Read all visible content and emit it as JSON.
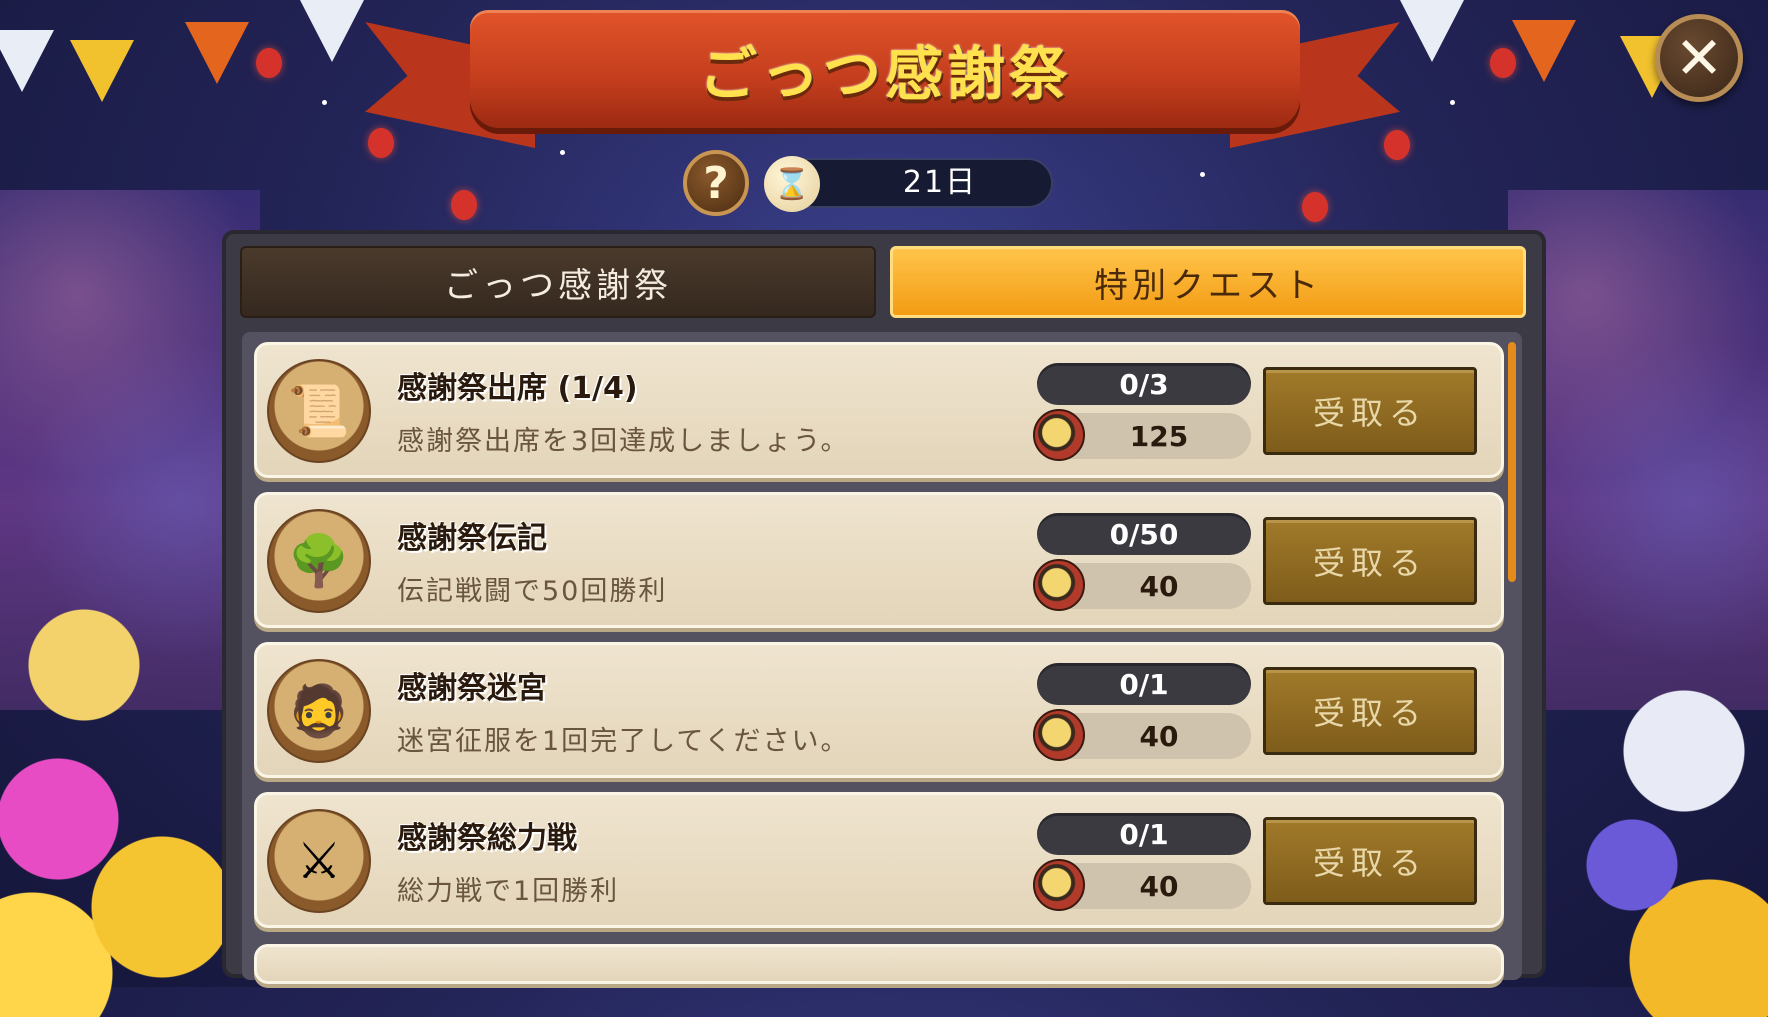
{
  "header": {
    "title": "ごっつ感謝祭",
    "help_label": "?",
    "close_label": "✕",
    "timer": {
      "icon": "hourglass-icon",
      "value": "21日"
    }
  },
  "tabs": [
    {
      "label": "ごっつ感謝祭",
      "active": false
    },
    {
      "label": "特別クエスト",
      "active": true
    }
  ],
  "quests": [
    {
      "icon": "scroll-icon",
      "title": "感謝祭出席 (1/4)",
      "description": "感謝祭出席を3回達成しましょう。",
      "progress": "0/3",
      "reward": "125",
      "claim_label": "受取る"
    },
    {
      "icon": "forest-battle-icon",
      "title": "感謝祭伝記",
      "description": "伝記戦闘で50回勝利",
      "progress": "0/50",
      "reward": "40",
      "claim_label": "受取る"
    },
    {
      "icon": "warrior-icon",
      "title": "感謝祭迷宮",
      "description": "迷宮征服を1回完了してください。",
      "progress": "0/1",
      "reward": "40",
      "claim_label": "受取る"
    },
    {
      "icon": "soldier-icon",
      "title": "感謝祭総力戦",
      "description": "総力戦で1回勝利",
      "progress": "0/1",
      "reward": "40",
      "claim_label": "受取る"
    }
  ],
  "colors": {
    "active_tab": "#f39c14",
    "ribbon": "#c33d1d",
    "title_text": "#ffe14d",
    "claim_button": "#8a6420"
  }
}
